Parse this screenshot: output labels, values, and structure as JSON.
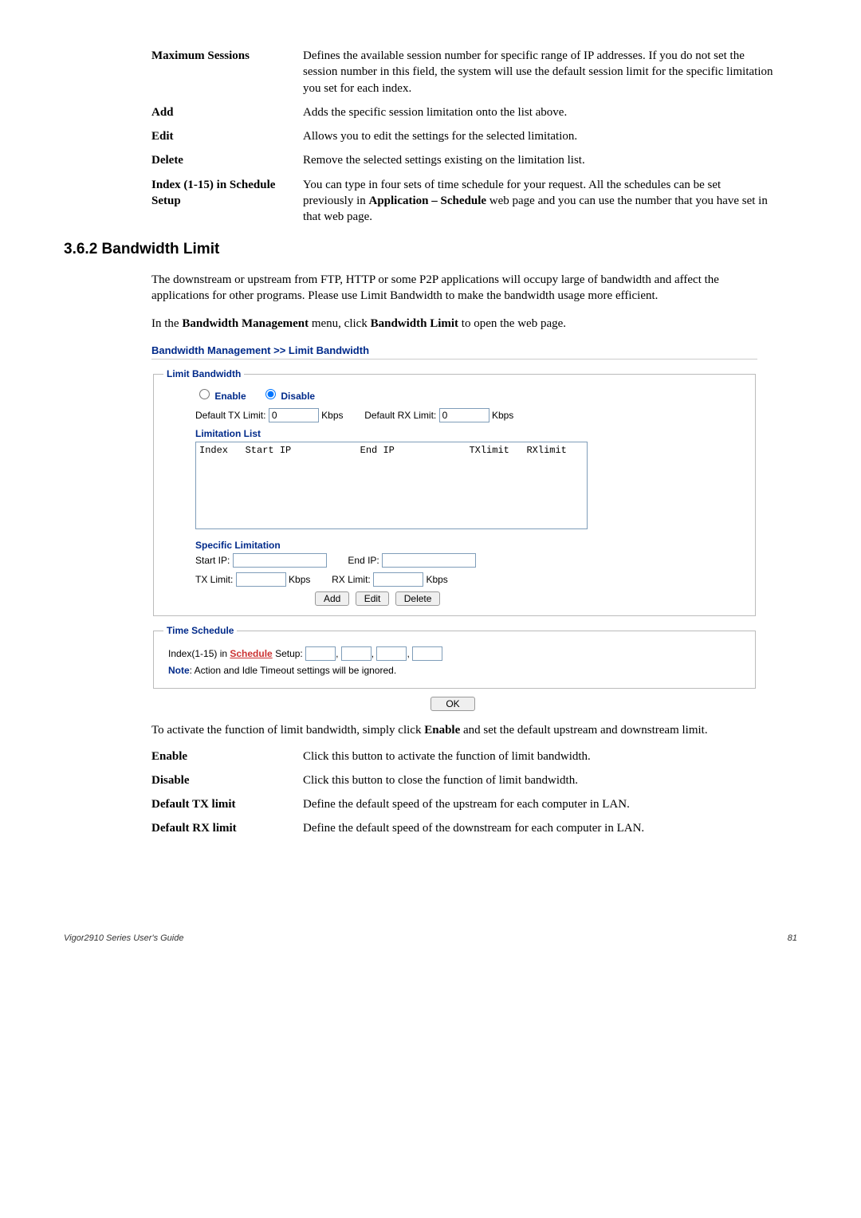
{
  "defs1": [
    {
      "term": "Maximum Sessions",
      "desc": "Defines the available session number for specific range of IP addresses. If you do not set the session number in this field, the system will use the default session limit for the specific limitation you set for each index."
    },
    {
      "term": "Add",
      "desc": "Adds the specific session limitation onto the list above."
    },
    {
      "term": "Edit",
      "desc": "Allows you to edit the settings for the selected limitation."
    },
    {
      "term": "Delete",
      "desc": "Remove the selected settings existing on the limitation list."
    },
    {
      "term": "Index (1-15) in Schedule Setup",
      "desc": "You can type in four sets of time schedule for your request. All the schedules can be set previously in Application – Schedule web page and you can use the number that you have set in that web page."
    }
  ],
  "section_heading": "3.6.2 Bandwidth Limit",
  "para1": "The downstream or upstream from FTP, HTTP or some P2P applications will occupy large of bandwidth and affect the applications for other programs. Please use Limit Bandwidth to make the bandwidth usage more efficient.",
  "para2_pre": "In the ",
  "para2_b1": "Bandwidth Management",
  "para2_mid": " menu, click ",
  "para2_b2": "Bandwidth Limit",
  "para2_post": " to open the web page.",
  "panel_title": "Bandwidth Management >> Limit Bandwidth",
  "limit_legend": "Limit Bandwidth",
  "enable_label": "Enable",
  "disable_label": "Disable",
  "default_tx_label": "Default TX Limit:",
  "default_tx_value": "0",
  "default_rx_label": "Default RX Limit:",
  "default_rx_value": "0",
  "kbps": "Kbps",
  "limitation_list_label": "Limitation List",
  "list_header": "Index   Start IP            End IP             TXlimit   RXlimit",
  "specific_limitation_label": "Specific Limitation",
  "start_ip_label": "Start IP:",
  "end_ip_label": "End IP:",
  "tx_limit_label": "TX Limit:",
  "rx_limit_label": "RX Limit:",
  "add_btn": "Add",
  "edit_btn": "Edit",
  "delete_btn": "Delete",
  "time_legend": "Time Schedule",
  "index_setup_pre": "Index(1-15) in ",
  "schedule_link": "Schedule",
  "index_setup_post": " Setup:",
  "note_label": "Note",
  "note_text": ": Action and Idle Timeout settings will be ignored.",
  "ok_btn": "OK",
  "para3_pre": "To activate the function of limit bandwidth, simply click ",
  "para3_b": "Enable",
  "para3_post": " and set the default upstream and downstream limit.",
  "defs2": [
    {
      "term": "Enable",
      "desc": "Click this button to activate the function of limit bandwidth."
    },
    {
      "term": "Disable",
      "desc": "Click this button to close the function of limit bandwidth."
    },
    {
      "term": "Default TX limit",
      "desc": "Define the default speed of the upstream for each computer in LAN."
    },
    {
      "term": "Default RX limit",
      "desc": "Define the default speed of the downstream for each computer in LAN."
    }
  ],
  "footer_left": "Vigor2910 Series User's Guide",
  "footer_right": "81"
}
